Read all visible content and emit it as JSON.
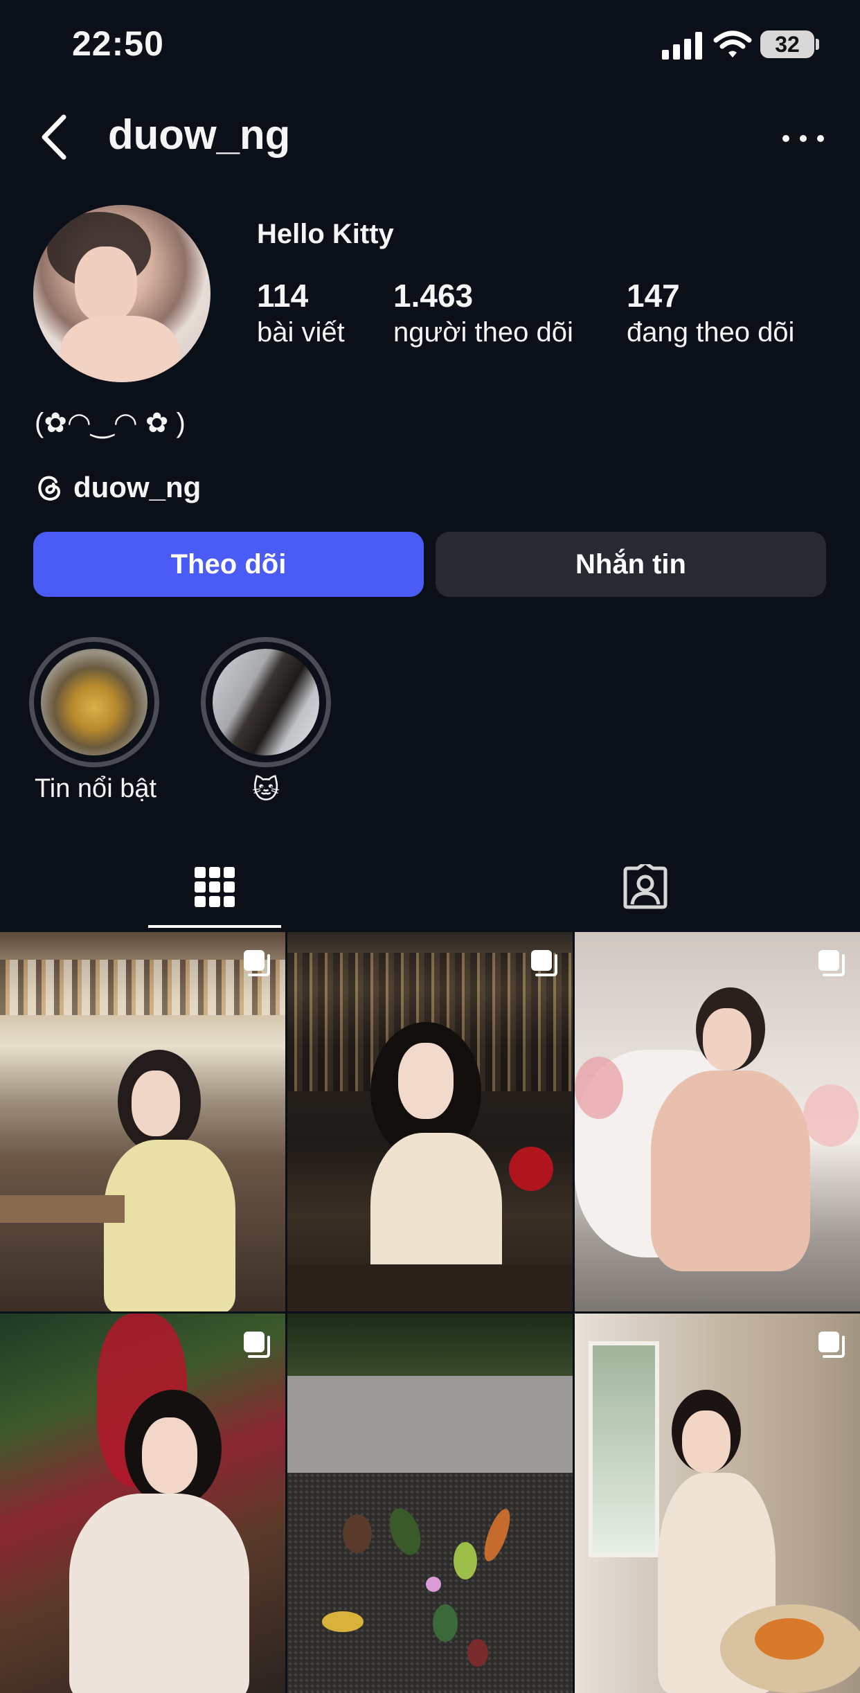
{
  "status_bar": {
    "time": "22:50",
    "battery": "32"
  },
  "header": {
    "username": "duow_ng"
  },
  "profile": {
    "display_name": "Hello Kitty",
    "stats": [
      {
        "value": "114",
        "label": "bài viết"
      },
      {
        "value": "1.463",
        "label": "người theo dõi"
      },
      {
        "value": "147",
        "label": "đang theo dõi"
      }
    ],
    "bio": "(✿◠‿◠ ✿ )",
    "threads_handle": "duow_ng"
  },
  "actions": {
    "follow_label": "Theo dõi",
    "message_label": "Nhắn tin"
  },
  "highlights": [
    {
      "label": "Tin nổi bật"
    },
    {
      "label": "🐱"
    }
  ],
  "tabs": [
    {
      "icon": "grid-icon",
      "active": true
    },
    {
      "icon": "tagged-icon",
      "active": false
    }
  ],
  "posts": [
    {
      "kind": "carousel",
      "theme": "bar-yellow"
    },
    {
      "kind": "carousel",
      "theme": "bar-dark"
    },
    {
      "kind": "carousel",
      "theme": "pink-dress"
    },
    {
      "kind": "carousel",
      "theme": "christmas"
    },
    {
      "kind": "still-life",
      "theme": "stones"
    },
    {
      "kind": "carousel",
      "theme": "window"
    }
  ],
  "colors": {
    "accent": "#4b5cf6",
    "background": "#0b0f17",
    "secondary_button": "#272a31"
  }
}
